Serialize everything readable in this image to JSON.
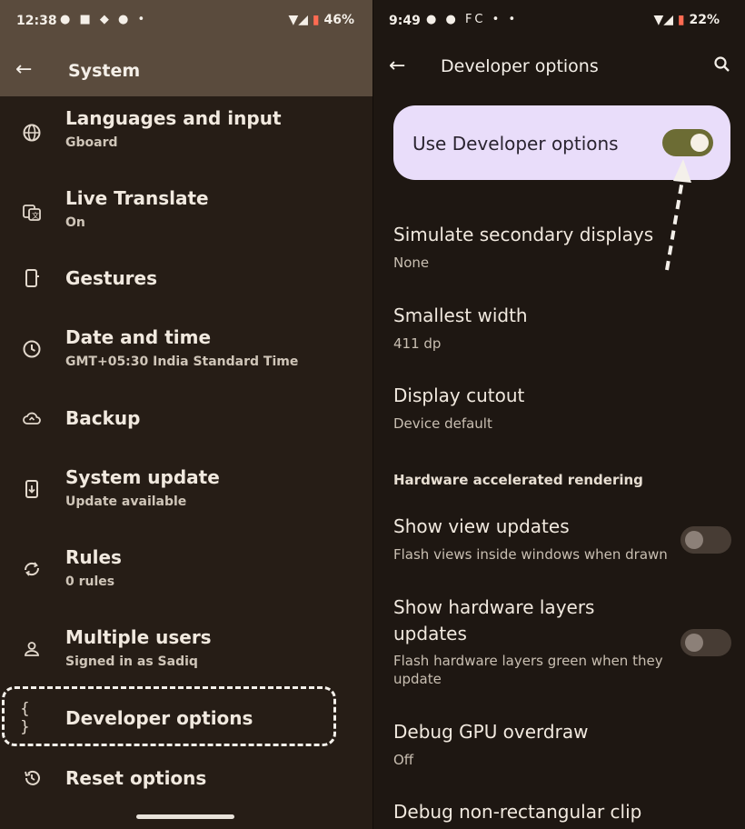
{
  "left": {
    "status": {
      "time": "12:38",
      "notifications": "● ■ ◆ ● •",
      "battery": "46%"
    },
    "appbar": {
      "title": "System"
    },
    "items": [
      {
        "title": "Languages and input",
        "subtitle": "Gboard",
        "icon": "globe-icon"
      },
      {
        "title": "Live Translate",
        "subtitle": "On",
        "icon": "translate-icon"
      },
      {
        "title": "Gestures",
        "subtitle": "",
        "icon": "gestures-phone-icon"
      },
      {
        "title": "Date and time",
        "subtitle": "GMT+05:30 India Standard Time",
        "icon": "clock-icon"
      },
      {
        "title": "Backup",
        "subtitle": "",
        "icon": "cloud-upload-icon"
      },
      {
        "title": "System update",
        "subtitle": "Update available",
        "icon": "system-update-icon"
      },
      {
        "title": "Rules",
        "subtitle": "0 rules",
        "icon": "rules-icon"
      },
      {
        "title": "Multiple users",
        "subtitle": "Signed in as Sadiq",
        "icon": "person-icon"
      },
      {
        "title": "Developer options",
        "subtitle": "",
        "icon": "code-braces-icon"
      },
      {
        "title": "Reset options",
        "subtitle": "",
        "icon": "reset-history-icon"
      }
    ]
  },
  "right": {
    "status": {
      "time": "9:49",
      "notifications": "● ● FC • •",
      "battery": "22%"
    },
    "appbar": {
      "title": "Developer options"
    },
    "use_dev": {
      "label": "Use Developer options",
      "enabled": true
    },
    "items": [
      {
        "title": "Simulate secondary displays",
        "subtitle": "None"
      },
      {
        "title": "Smallest width",
        "subtitle": "411 dp"
      },
      {
        "title": "Display cutout",
        "subtitle": "Device default"
      }
    ],
    "section_header": "Hardware accelerated rendering",
    "hw_items": [
      {
        "title": "Show view updates",
        "subtitle": "Flash views inside windows when drawn",
        "enabled": false
      },
      {
        "title_line1": "Show hardware layers",
        "title_line2": "updates",
        "subtitle_line1": "Flash hardware layers green when they",
        "subtitle_line2": "update",
        "enabled": false
      },
      {
        "title": "Debug GPU overdraw",
        "subtitle": "Off"
      },
      {
        "title": "Debug non-rectangular clip",
        "subtitle": ""
      }
    ]
  },
  "colors": {
    "accent_toggle": "#6c6c34",
    "card": "#e9ddfa",
    "appbar_left": "#5a4b3d"
  }
}
